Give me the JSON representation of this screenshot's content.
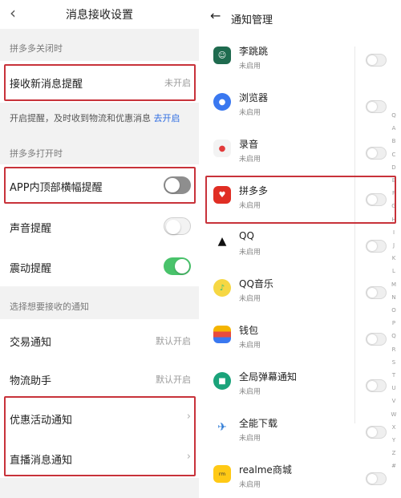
{
  "left": {
    "header": {
      "back_icon": "chevron-left",
      "title": "消息接收设置"
    },
    "section_closed": "拼多多关闭时",
    "new_message": {
      "label": "接收新消息提醒",
      "value": "未开启"
    },
    "new_message_desc": {
      "text": "开启提醒，及时收到物流和优惠消息 ",
      "link": "去开启"
    },
    "section_open": "拼多多打开时",
    "banner": {
      "label": "APP内顶部横幅提醒",
      "state": "off"
    },
    "sound": {
      "label": "声音提醒",
      "state": "off"
    },
    "vibrate": {
      "label": "震动提醒",
      "state": "on"
    },
    "section_choose": "选择想要接收的通知",
    "trade": {
      "label": "交易通知",
      "value": "默认开启"
    },
    "logistics": {
      "label": "物流助手",
      "value": "默认开启"
    },
    "promo": {
      "label": "优惠活动通知"
    },
    "live": {
      "label": "直播消息通知"
    },
    "highlight_color": "#c8323a",
    "toggle_on_color": "#49c36b"
  },
  "right": {
    "header": {
      "back_icon": "arrow-left",
      "title": "通知管理"
    },
    "apps": [
      {
        "name": "李跳跳",
        "status": "未启用",
        "icon": "lee-app-icon",
        "color": "#1f6b4f"
      },
      {
        "name": "浏览器",
        "status": "未启用",
        "icon": "browser-icon",
        "color": "#3a78f0"
      },
      {
        "name": "录音",
        "status": "未启用",
        "icon": "recorder-icon",
        "color": "#e23a3a"
      },
      {
        "name": "拼多多",
        "status": "未启用",
        "icon": "pinduoduo-icon",
        "color": "#e02e24"
      },
      {
        "name": "QQ",
        "status": "未启用",
        "icon": "qq-penguin-icon",
        "color": "#111111"
      },
      {
        "name": "QQ音乐",
        "status": "未启用",
        "icon": "qq-music-icon",
        "color": "#31c27c"
      },
      {
        "name": "钱包",
        "status": "未启用",
        "icon": "wallet-icon",
        "color": "#f4b400"
      },
      {
        "name": "全局弹幕通知",
        "status": "未启用",
        "icon": "bullet-chat-icon",
        "color": "#1aa37a"
      },
      {
        "name": "全能下载",
        "status": "未启用",
        "icon": "download-icon",
        "color": "#2e7bd6"
      },
      {
        "name": "realme商城",
        "status": "未启用",
        "icon": "realme-store-icon",
        "color": "#ffc915"
      }
    ],
    "alphabet": [
      "Q",
      "A",
      "B",
      "C",
      "D",
      "E",
      "F",
      "G",
      "H",
      "I",
      "J",
      "K",
      "L",
      "M",
      "N",
      "O",
      "P",
      "Q",
      "R",
      "S",
      "T",
      "U",
      "V",
      "W",
      "X",
      "Y",
      "Z",
      "#"
    ]
  }
}
